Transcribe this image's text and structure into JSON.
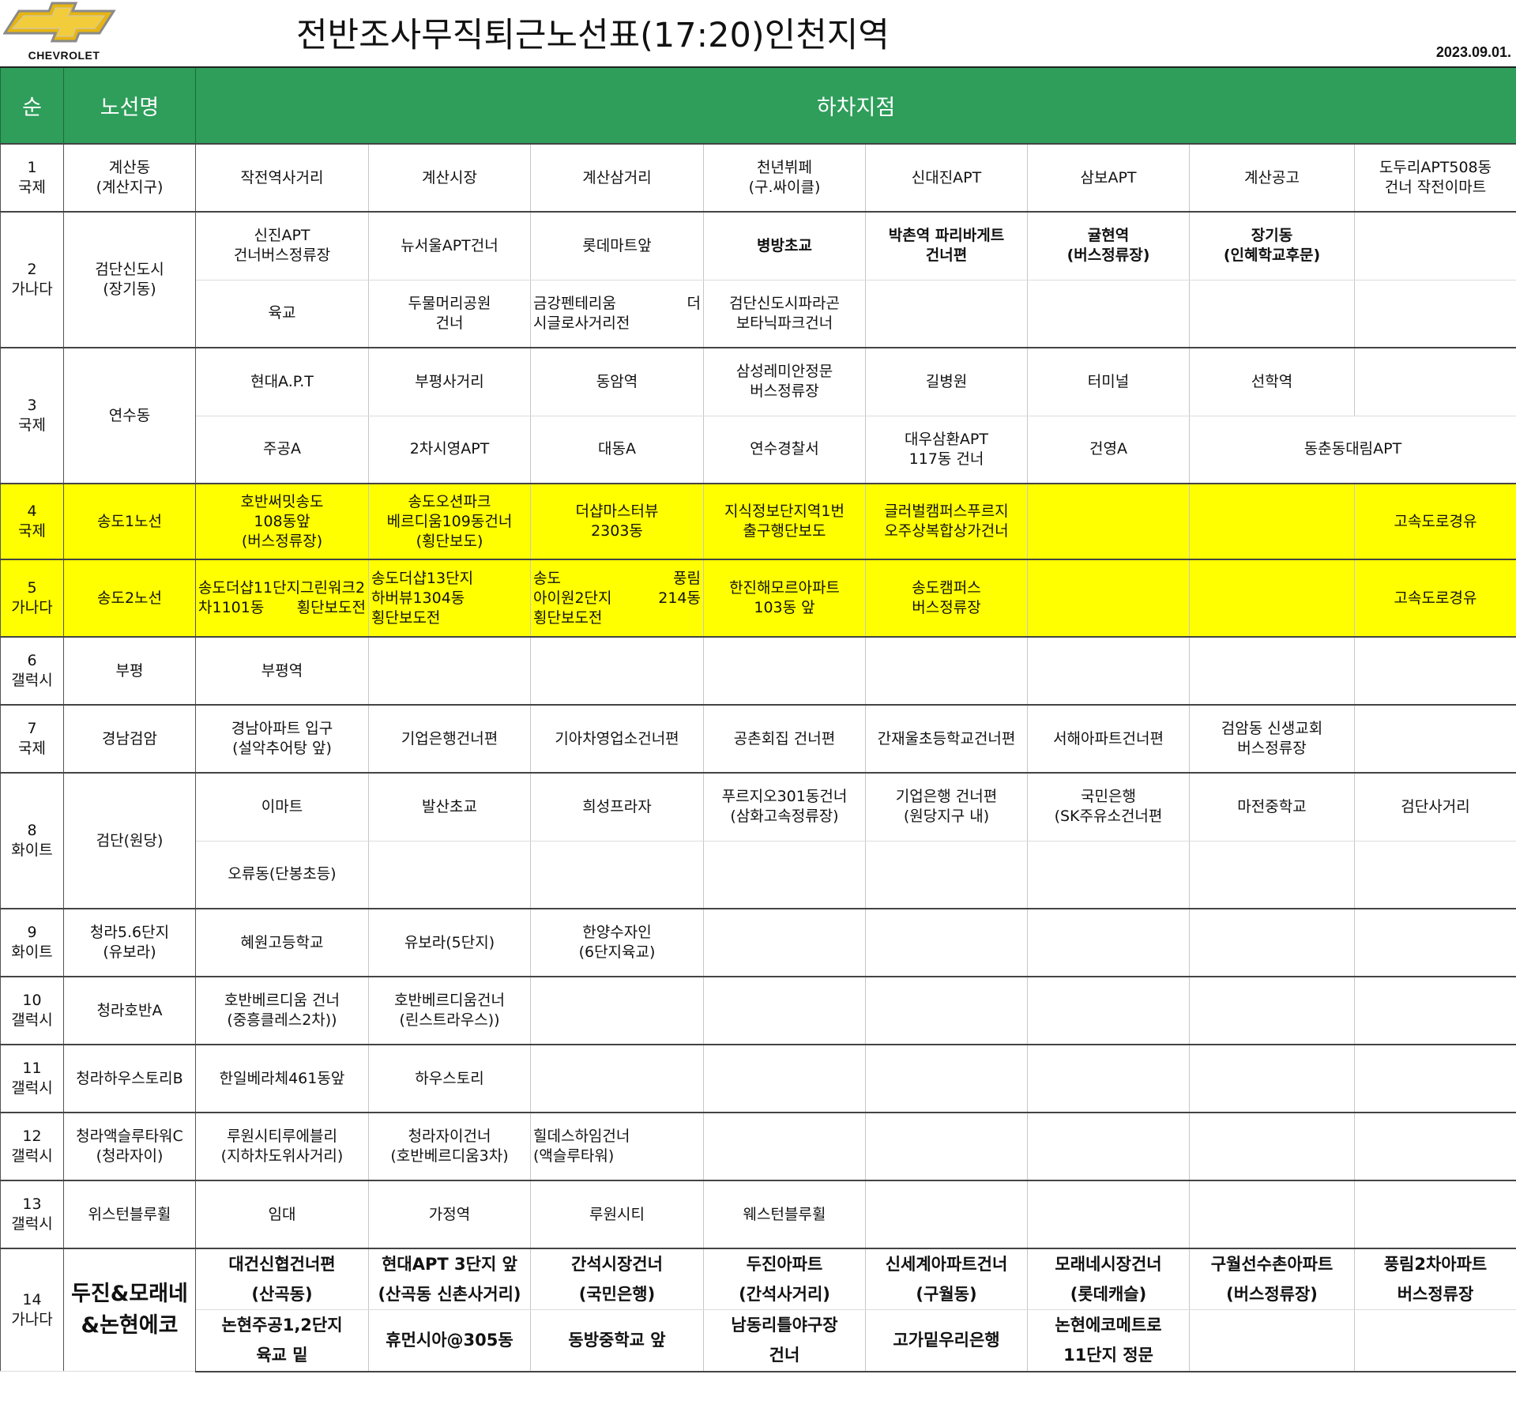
{
  "header": {
    "brand": "CHEVROLET",
    "title": "전반조사무직퇴근노선표(17:20)인천지역",
    "date": "2023.09.01.",
    "colors": {
      "brand_gold": "#e7b512",
      "header_green": "#2e9e5a",
      "highlight": "#ffff00"
    }
  },
  "table": {
    "col_no": "순",
    "col_route": "노선명",
    "col_stops": "하차지점"
  },
  "routes": [
    {
      "no": "1",
      "vendor": "국제",
      "name": "계산동\n(계산지구)",
      "stops": [
        [
          "작전역사거리",
          "계산시장",
          "계산삼거리",
          "천년뷔페\n(구.싸이클)",
          "신대진APT",
          "삼보APT",
          "계산공고",
          "도두리APT508동\n건너 작전이마트"
        ]
      ]
    },
    {
      "no": "2",
      "vendor": "가나다",
      "name": "검단신도시\n(장기동)",
      "stops": [
        [
          "신진APT\n건너버스정류장",
          "뉴서울APT건너",
          "롯데마트앞",
          "병방초교",
          "박촌역 파리바게트\n건너편",
          "귤현역\n(버스정류장)",
          "장기동\n(인혜학교후문)",
          ""
        ],
        [
          "육교",
          "두물머리공원\n건너",
          "금강펜테리움 더\n시글로사거리전",
          "검단신도시파라곤\n보타닉파크건너",
          "",
          "",
          "",
          ""
        ]
      ]
    },
    {
      "no": "3",
      "vendor": "국제",
      "name": "연수동",
      "stops": [
        [
          "현대A.P.T",
          "부평사거리",
          "동암역",
          "삼성레미안정문\n버스정류장",
          "길병원",
          "터미널",
          "선학역",
          ""
        ],
        [
          "주공A",
          "2차시영APT",
          "대동A",
          "연수경찰서",
          "대우삼환APT\n117동 건너",
          "건영A",
          "동춘동대림APT"
        ]
      ]
    },
    {
      "no": "4",
      "vendor": "국제",
      "name": "송도1노선",
      "stops": [
        [
          "호반써밋송도\n108동앞\n(버스정류장)",
          "송도오션파크\n베르디움109동건너\n(횡단보도)",
          "더샵마스터뷰\n2303동",
          "지식정보단지역1번\n출구행단보도",
          "글러벌캠퍼스푸르지\n오주상복합상가건너",
          "",
          "",
          "고속도로경유"
        ]
      ]
    },
    {
      "no": "5",
      "vendor": "가나다",
      "name": "송도2노선",
      "stops": [
        [
          "송도더샵11단지그린워크2차1101동 횡단보도전",
          "송도더샵13단지\n하버뷰1304동 횡단보도전",
          "송도 풍림\n아이원2단지 214동\n횡단보도전",
          "한진해모르아파트\n103동 앞",
          "송도캠퍼스\n버스정류장",
          "",
          "",
          "고속도로경유"
        ]
      ]
    },
    {
      "no": "6",
      "vendor": "갤럭시",
      "name": "부평",
      "stops": [
        [
          "부평역",
          "",
          "",
          "",
          "",
          "",
          "",
          ""
        ]
      ]
    },
    {
      "no": "7",
      "vendor": "국제",
      "name": "경남검암",
      "stops": [
        [
          "경남아파트 입구\n(설악추어탕 앞)",
          "기업은행건너편",
          "기아차영업소건너편",
          "공촌회집 건너편",
          "간재울초등학교건너편",
          "서해아파트건너편",
          "검암동 신생교회\n버스정류장",
          ""
        ]
      ]
    },
    {
      "no": "8",
      "vendor": "화이트",
      "name": "검단(원당)",
      "stops": [
        [
          "이마트",
          "발산초교",
          "희성프라자",
          "푸르지오301동건너\n(삼화고속정류장)",
          "기업은행 건너편\n(원당지구 내)",
          "국민은행\n(SK주유소건너편",
          "마전중학교",
          "검단사거리"
        ],
        [
          "오류동(단봉초등)",
          "",
          "",
          "",
          "",
          "",
          "",
          ""
        ]
      ]
    },
    {
      "no": "9",
      "vendor": "화이트",
      "name": "청라5.6단지\n(유보라)",
      "stops": [
        [
          "혜원고등학교",
          "유보라(5단지)",
          "한양수자인\n(6단지육교)",
          "",
          "",
          "",
          "",
          ""
        ]
      ]
    },
    {
      "no": "10",
      "vendor": "갤럭시",
      "name": "청라호반A",
      "stops": [
        [
          "호반베르디움 건너\n(중흥클레스2차))",
          "호반베르디움건너\n(린스트라우스))",
          "",
          "",
          "",
          "",
          "",
          ""
        ]
      ]
    },
    {
      "no": "11",
      "vendor": "갤럭시",
      "name": "청라하우스토리B",
      "stops": [
        [
          "한일베라체461동앞",
          "하우스토리",
          "",
          "",
          "",
          "",
          "",
          ""
        ]
      ]
    },
    {
      "no": "12",
      "vendor": "갤럭시",
      "name": "청라액슬루타워C\n(청라자이)",
      "stops": [
        [
          "루원시티루에블리\n(지하차도위사거리)",
          "청라자이건너\n(호반베르디움3차)",
          "힐데스하임건너 (액슬루타워)",
          "",
          "",
          "",
          "",
          ""
        ]
      ]
    },
    {
      "no": "13",
      "vendor": "갤럭시",
      "name": "위스턴블루휠",
      "stops": [
        [
          "임대",
          "가정역",
          "루원시티",
          "웨스턴블루휠",
          "",
          "",
          "",
          ""
        ]
      ]
    },
    {
      "no": "14",
      "vendor": "가나다",
      "name": "두진&모래네\n&논현에코",
      "stops": [
        [
          "대건신협건너편\n(산곡동)",
          "현대APT 3단지 앞\n(산곡동 신촌사거리)",
          "간석시장건너\n(국민은행)",
          "두진아파트\n(간석사거리)",
          "신세계아파트건너\n(구월동)",
          "모래네시장건너\n(롯데캐슬)",
          "구월선수촌아파트\n(버스정류장)",
          "풍림2차아파트\n버스정류장"
        ],
        [
          "논현주공1,2단지\n육교 밑",
          "휴먼시아@305동",
          "동방중학교 앞",
          "남동리틀야구장\n건너",
          "고가밑우리은행",
          "논현에코메트로\n11단지 정문",
          "",
          ""
        ]
      ]
    }
  ]
}
